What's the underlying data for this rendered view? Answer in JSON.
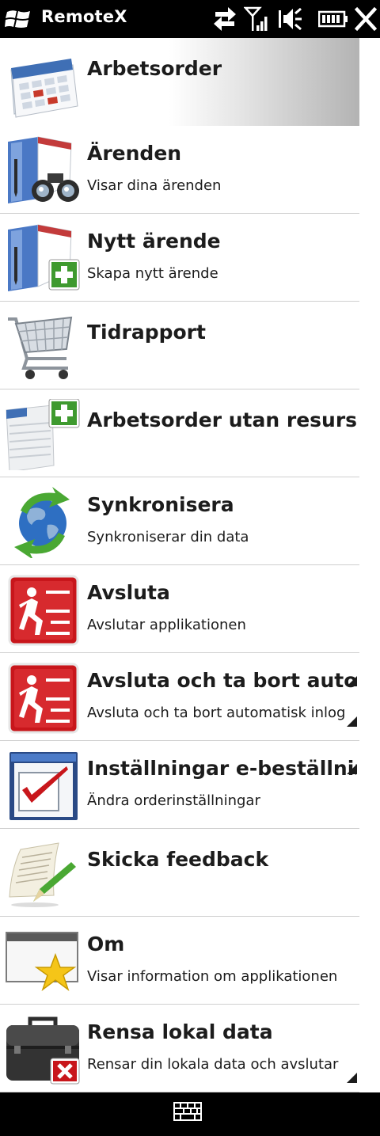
{
  "status_bar": {
    "app_title": "RemoteX",
    "icons": [
      "windows-start-icon",
      "connectivity-icon",
      "signal-icon",
      "speaker-muted-icon",
      "battery-icon",
      "close-icon"
    ]
  },
  "menu": {
    "items": [
      {
        "title": "Arbetsorder",
        "subtitle": "",
        "icon": "calendar-icon",
        "selected": true
      },
      {
        "title": "Ärenden",
        "subtitle": "Visar dina ärenden",
        "icon": "binoculars-book-icon"
      },
      {
        "title": "Nytt ärende",
        "subtitle": "Skapa nytt ärende",
        "icon": "book-add-icon"
      },
      {
        "title": "Tidrapport",
        "subtitle": "",
        "icon": "shopping-cart-icon"
      },
      {
        "title": "Arbetsorder utan resurs",
        "subtitle": "",
        "icon": "document-add-icon"
      },
      {
        "title": "Synkronisera",
        "subtitle": "Synkroniserar din data",
        "icon": "globe-sync-icon"
      },
      {
        "title": "Avsluta",
        "subtitle": "Avslutar applikationen",
        "icon": "exit-icon"
      },
      {
        "title": "Avsluta och ta bort auto",
        "subtitle": "Avsluta och ta bort automatisk inlog",
        "icon": "exit-icon"
      },
      {
        "title": "Inställningar e-beställnin",
        "subtitle": "Ändra orderinställningar",
        "icon": "checkbox-window-icon"
      },
      {
        "title": "Skicka feedback",
        "subtitle": "",
        "icon": "paper-pen-icon"
      },
      {
        "title": "Om",
        "subtitle": "Visar information om applikationen",
        "icon": "window-star-icon"
      },
      {
        "title": "Rensa lokal data",
        "subtitle": "Rensar din lokala data och avslutar",
        "icon": "briefcase-delete-icon"
      }
    ]
  },
  "bottom_bar": {
    "icon": "keyboard-icon"
  },
  "colors": {
    "bar": "#000000",
    "list_bg": "#ffffff",
    "text": "#1c1c1c",
    "accent_green": "#3f9a2f",
    "accent_red": "#c8161b"
  }
}
